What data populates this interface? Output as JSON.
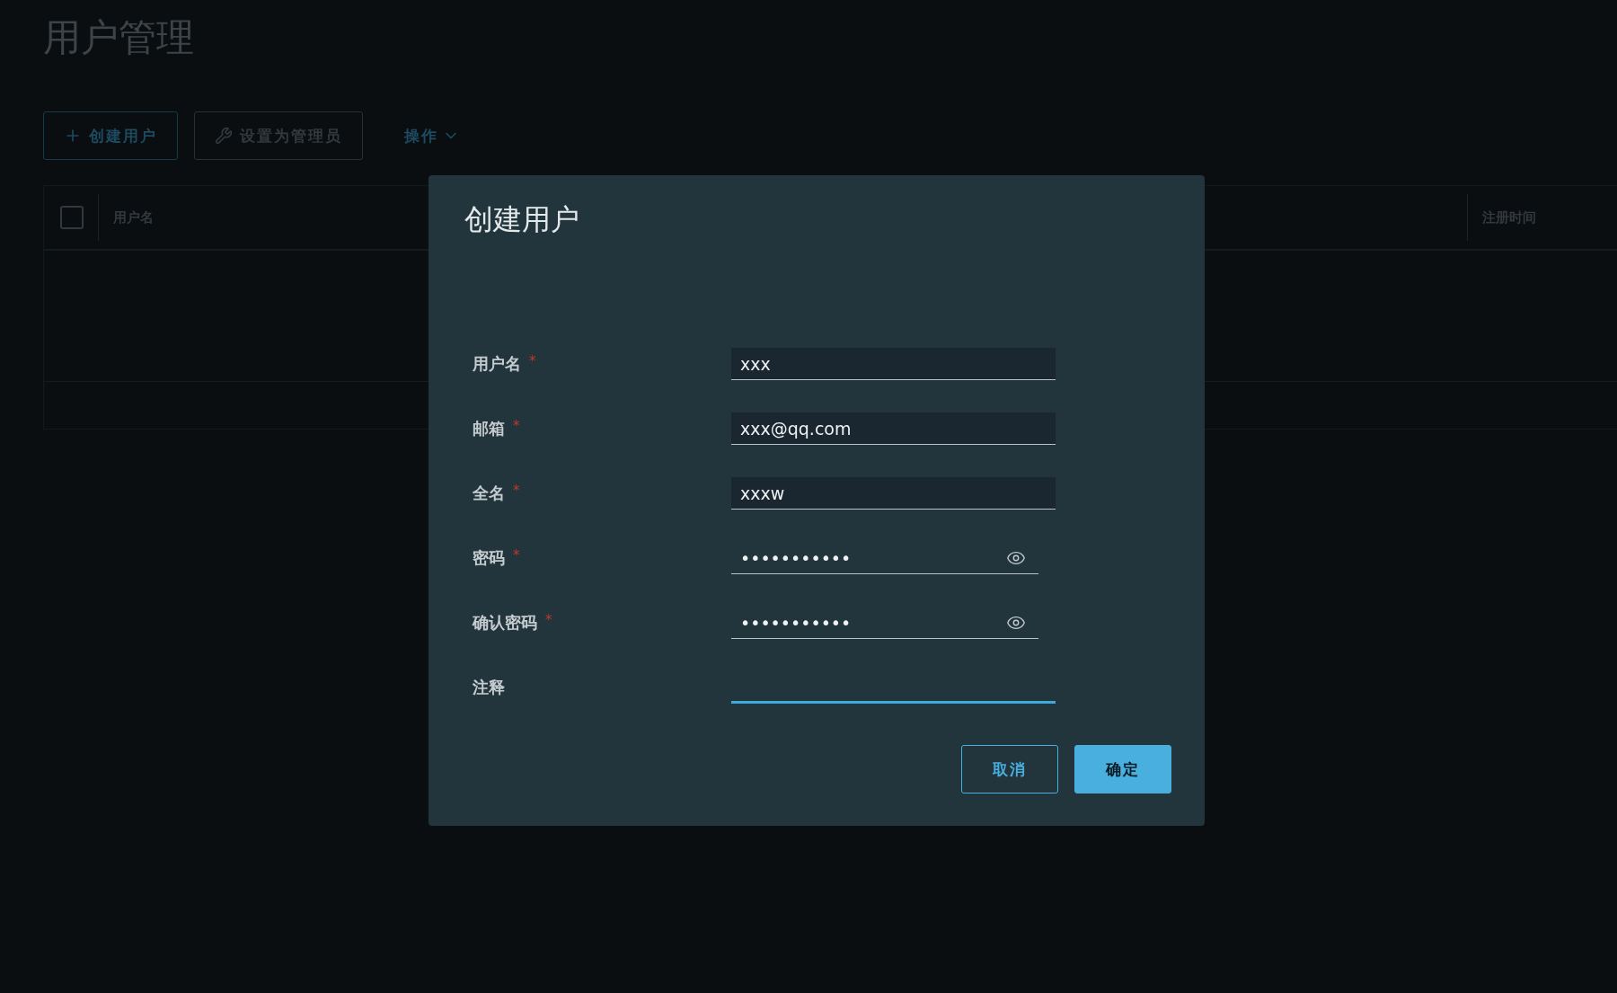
{
  "page": {
    "title": "用户管理"
  },
  "toolbar": {
    "buttons": [
      {
        "label": "创建用户",
        "kind": "create",
        "disabled": false
      },
      {
        "label": "设置为管理员",
        "kind": "admin",
        "disabled": true
      }
    ],
    "actions_menu": {
      "label": "操作"
    }
  },
  "table": {
    "select_all": {
      "checked": false
    },
    "columns": [
      {
        "label": "用户名"
      },
      {
        "label": "注册时间"
      }
    ]
  },
  "dialog": {
    "title": "创建用户",
    "fields": [
      {
        "label": "用户名",
        "required_mark": "*",
        "kind": "text",
        "value": "xxx",
        "focused": false
      },
      {
        "label": "邮箱",
        "required_mark": "*",
        "kind": "text",
        "value": "xxx@qq.com",
        "focused": false
      },
      {
        "label": "全名",
        "required_mark": "*",
        "kind": "text",
        "value": "xxxw",
        "focused": false
      },
      {
        "label": "密码",
        "required_mark": "*",
        "kind": "password",
        "value": "•••••••••••",
        "focused": false
      },
      {
        "label": "确认密码",
        "required_mark": "*",
        "kind": "password",
        "value": "•••••••••••",
        "focused": false
      },
      {
        "label": "注释",
        "kind": "text",
        "focused": true
      }
    ],
    "buttons": [
      {
        "label": "取消",
        "kind": "secondary"
      },
      {
        "label": "确定",
        "kind": "primary"
      }
    ]
  }
}
